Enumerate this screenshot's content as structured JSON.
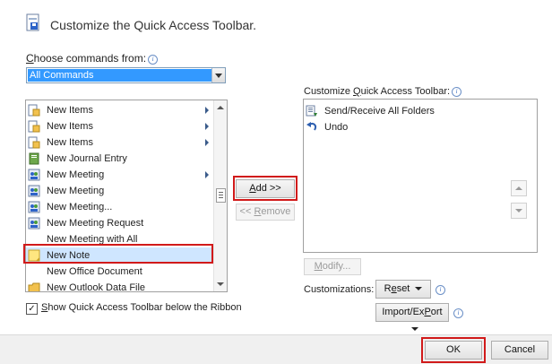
{
  "header": {
    "title": "Customize the Quick Access Toolbar."
  },
  "choose": {
    "label_pre": "",
    "label_key": "C",
    "label_post": "hoose commands from:",
    "selected": "All Commands"
  },
  "left_list": {
    "items": [
      {
        "label": "New Items",
        "icon": "new-items-icon",
        "submenu": true
      },
      {
        "label": "New Items",
        "icon": "new-items-icon",
        "submenu": true
      },
      {
        "label": "New Items",
        "icon": "new-items-icon",
        "submenu": true
      },
      {
        "label": "New Journal Entry",
        "icon": "journal-icon",
        "submenu": false
      },
      {
        "label": "New Meeting",
        "icon": "meeting-icon",
        "submenu": true
      },
      {
        "label": "New Meeting",
        "icon": "meeting-icon",
        "submenu": false
      },
      {
        "label": "New Meeting...",
        "icon": "meeting-icon",
        "submenu": false
      },
      {
        "label": "New Meeting Request",
        "icon": "meeting-icon",
        "submenu": false
      },
      {
        "label": "New Meeting with All",
        "icon": "",
        "submenu": false
      },
      {
        "label": "New Note",
        "icon": "note-icon",
        "submenu": false,
        "selected": true
      },
      {
        "label": "New Office Document",
        "icon": "",
        "submenu": false
      },
      {
        "label": "New Outlook Data File",
        "icon": "data-file-icon",
        "submenu": false
      }
    ]
  },
  "buttons": {
    "add_key": "A",
    "add_rest": "dd >>",
    "remove_pre": "<< ",
    "remove_key": "R",
    "remove_rest": "emove",
    "modify_key": "M",
    "modify_rest": "odify...",
    "reset_key": "e",
    "reset_pre": "R",
    "reset_rest": "set",
    "import_export_key": "P",
    "import_export_pre": "Import/Ex",
    "import_export_rest": "ort",
    "ok": "OK",
    "cancel": "Cancel"
  },
  "right_panel": {
    "label_pre": "Customize ",
    "label_key": "Q",
    "label_post": "uick Access Toolbar:",
    "items": [
      {
        "label": "Send/Receive All Folders",
        "icon": "send-receive-icon"
      },
      {
        "label": "Undo",
        "icon": "undo-icon"
      }
    ],
    "customizations_label": "Customizations:"
  },
  "show_below": {
    "checked": true,
    "key": "S",
    "rest": "how Quick Access Toolbar below the Ribbon"
  },
  "colors": {
    "highlight": "#3399ff",
    "redbox": "#d11a1a"
  }
}
